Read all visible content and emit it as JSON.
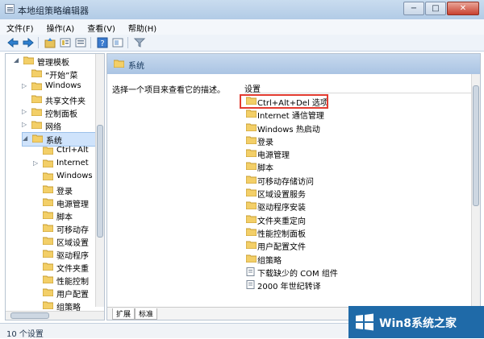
{
  "window": {
    "title": "本地组策略编辑器",
    "buttons": {
      "minimize": "−",
      "maximize": "□",
      "close": "✕"
    }
  },
  "menus": [
    "文件(F)",
    "操作(A)",
    "查看(V)",
    "帮助(H)"
  ],
  "toolbar": {
    "icons": [
      "back-icon",
      "forward-icon",
      "up-icon",
      "list-icon",
      "properties-icon",
      "help-icon",
      "view-icon",
      "filter-icon"
    ]
  },
  "tree": {
    "items": [
      {
        "label": "管理模板",
        "expanded": true
      },
      {
        "label": "“开始”菜",
        "expanded": false
      },
      {
        "label": "Windows",
        "expanded": false
      },
      {
        "label": "共享文件夹",
        "expanded": false
      },
      {
        "label": "控制面板",
        "expanded": false
      },
      {
        "label": "网络",
        "expanded": false
      },
      {
        "label": "系统",
        "expanded": true,
        "selected": true
      },
      {
        "label": "Ctrl+Alt",
        "expanded": false
      },
      {
        "label": "Internet",
        "expanded": false
      },
      {
        "label": "Windows",
        "expanded": false
      },
      {
        "label": "登录",
        "expanded": false
      },
      {
        "label": "电源管理",
        "expanded": false
      },
      {
        "label": "脚本",
        "expanded": false
      },
      {
        "label": "可移动存",
        "expanded": false
      },
      {
        "label": "区域设置",
        "expanded": false
      },
      {
        "label": "驱动程序",
        "expanded": false
      },
      {
        "label": "文件夹重",
        "expanded": false
      },
      {
        "label": "性能控制",
        "expanded": false
      },
      {
        "label": "用户配置",
        "expanded": false
      },
      {
        "label": "组策略",
        "expanded": false
      }
    ]
  },
  "right": {
    "header_title": "系统",
    "description": "选择一个项目来查看它的描述。",
    "settings_header": "设置",
    "settings": [
      "Ctrl+Alt+Del 选项",
      "Internet 通信管理",
      "Windows 热启动",
      "登录",
      "电源管理",
      "脚本",
      "可移动存储访问",
      "区域设置服务",
      "驱动程序安装",
      "文件夹重定向",
      "性能控制面板",
      "用户配置文件",
      "组策略",
      "下载缺少的 COM 组件",
      "2000 年世纪转译"
    ],
    "tabs": [
      "扩展",
      "标准"
    ]
  },
  "status": {
    "text": "10 个设置"
  },
  "watermark": {
    "text": "Win8系统之家"
  },
  "colors": {
    "titlebar": "#c9dcef",
    "selection": "#cfe3fb",
    "highlight_border": "#e23b30",
    "watermark": "#1f6aa8"
  }
}
